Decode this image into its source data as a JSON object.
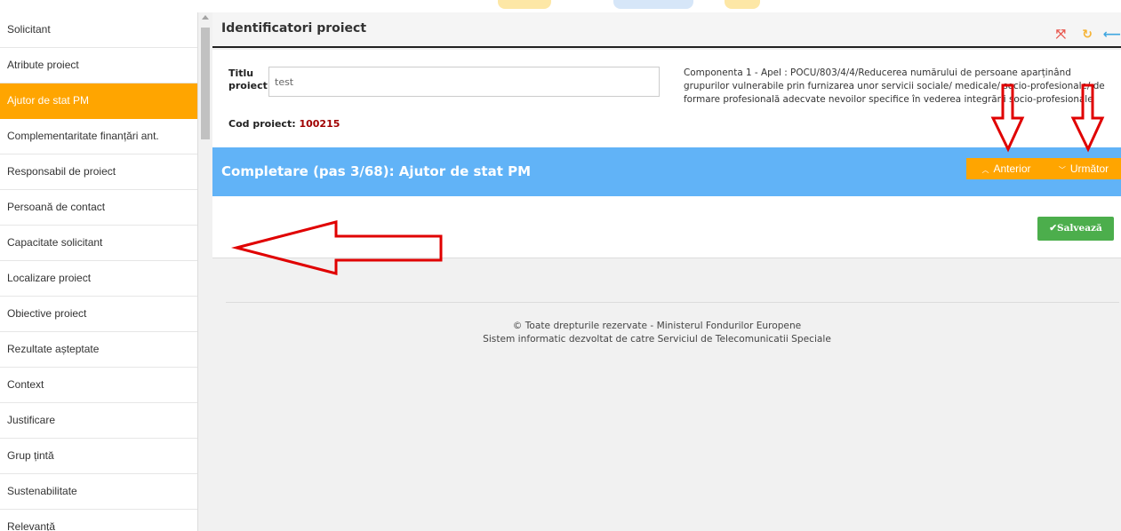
{
  "sidebar": {
    "items": [
      {
        "label": "Solicitant"
      },
      {
        "label": "Atribute proiect"
      },
      {
        "label": "Ajutor de stat PM"
      },
      {
        "label": "Complementaritate finanțări ant."
      },
      {
        "label": "Responsabil de proiect"
      },
      {
        "label": "Persoană de contact"
      },
      {
        "label": "Capacitate solicitant"
      },
      {
        "label": "Localizare proiect"
      },
      {
        "label": "Obiective proiect"
      },
      {
        "label": "Rezultate așteptate"
      },
      {
        "label": "Context"
      },
      {
        "label": "Justificare"
      },
      {
        "label": "Grup țintă"
      },
      {
        "label": "Sustenabilitate"
      },
      {
        "label": "Relevanță"
      }
    ],
    "active_index": 2
  },
  "header": {
    "title": "Identificatori proiect"
  },
  "project": {
    "title_label_1": "Titlu",
    "title_label_2": "proiect",
    "title_value": "test",
    "code_label": "Cod proiect:",
    "code_value": "100215",
    "componenta_text": "Componenta 1 - Apel : POCU/803/4/4/Reducerea numărului de persoane aparținând grupurilor vulnerabile prin furnizarea unor servicii sociale/ medicale/ socio-profesionale/ de formare profesională adecvate nevoilor specifice în vederea integrării socio-profesionale"
  },
  "step": {
    "title": "Completare (pas 3/68): Ajutor de stat PM",
    "prev_label": "Anterior",
    "next_label": "Următor"
  },
  "actions": {
    "save_label": "Salvează"
  },
  "footer": {
    "line1": "© Toate drepturile rezervate - Ministerul Fondurilor Europene",
    "line2": "Sistem informatic dezvoltat de catre Serviciul de Telecomunicatii Speciale"
  },
  "colors": {
    "accent_orange": "#ffa500",
    "step_bar_blue": "#61b3f7",
    "save_green": "#4cae4c",
    "code_red": "#a00000",
    "annotation_red": "#e00000"
  }
}
